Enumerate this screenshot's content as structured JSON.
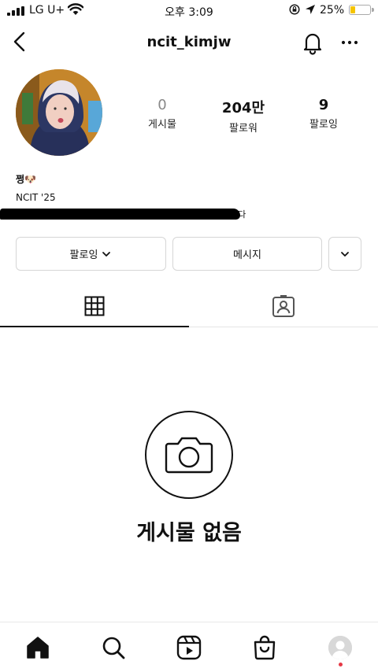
{
  "status_bar": {
    "carrier": "LG U+",
    "time": "오후 3:09",
    "battery_percent": "25%",
    "battery_level": 0.25
  },
  "header": {
    "username": "ncit_kimjw"
  },
  "stats": {
    "posts": {
      "value": "0",
      "label": "게시물"
    },
    "followers": {
      "value": "204만",
      "label": "팔로워"
    },
    "following": {
      "value": "9",
      "label": "팔로잉"
    }
  },
  "bio": {
    "name": "쩡🐶",
    "line1": "NCIT '25",
    "line2_visible": "니다"
  },
  "actions": {
    "following_label": "팔로잉",
    "message_label": "메시지"
  },
  "empty_state": {
    "text": "게시물 없음"
  },
  "colors": {
    "battery": "#f5c400",
    "notification_dot": "#e63946"
  },
  "icons": {
    "back": "chevron-left-icon",
    "bell": "bell-icon",
    "more": "more-horizontal-icon",
    "grid": "grid-icon",
    "tagged": "tagged-person-icon",
    "camera": "camera-icon",
    "home": "home-icon",
    "search": "search-icon",
    "reels": "reels-icon",
    "shop": "shop-bag-icon"
  }
}
